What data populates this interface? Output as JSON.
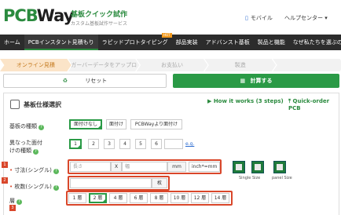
{
  "header": {
    "logo_part1": "PCB",
    "logo_part2": "Way",
    "title": "基板クイック試作",
    "subtitle": "カスタム基板試作サービス",
    "mobile": "モバイル",
    "help": "ヘルプセンター"
  },
  "nav": {
    "items": [
      {
        "label": "ホーム",
        "active": false
      },
      {
        "label": "PCBインスタント見積もり",
        "active": true
      },
      {
        "label": "ラピッドプロトタイピング",
        "active": false
      },
      {
        "label": "部品実装",
        "active": false
      },
      {
        "label": "アドバンスト基板",
        "active": false
      },
      {
        "label": "製品と機能",
        "active": false
      },
      {
        "label": "なぜ私たちを選ぶのか",
        "active": false
      }
    ],
    "badge": "HOT"
  },
  "steps": [
    {
      "label": "オンライン見積",
      "active": true
    },
    {
      "label": "ガーバーデータをアップロ",
      "active": false
    },
    {
      "label": "お支払い",
      "active": false
    },
    {
      "label": "製造",
      "active": false
    },
    {
      "label": "",
      "active": false
    }
  ],
  "actions": {
    "reset": "リセット",
    "calculate": "計算する"
  },
  "section": {
    "title": "基板仕様選択",
    "how_it_works": "How it works (3 steps)",
    "quick_order": "Quick-order PCB"
  },
  "board_type": {
    "label": "基板の種類",
    "options": [
      "面付けなし",
      "面付け",
      "PCBWayより面付け"
    ],
    "selected": 0
  },
  "different_designs": {
    "label_line1": "異なった面付",
    "label_line2": "けの種類",
    "options": [
      "1",
      "2",
      "3",
      "4",
      "5",
      "6"
    ],
    "selected": 0,
    "eg": "e.g."
  },
  "size": {
    "label": "寸法(シングル)",
    "length_placeholder": "長さ",
    "x": "X",
    "width_placeholder": "幅",
    "unit": "mm",
    "conversion": "inch*=mm",
    "single_size": "Single Size",
    "panel_size": "panel Size"
  },
  "quantity": {
    "label": "枚数(シングル)",
    "unit": "枚"
  },
  "layers": {
    "label": "層",
    "options": [
      "1 層",
      "2 層",
      "4 層",
      "6 層",
      "8 層",
      "10 層",
      "12 層",
      "14 層"
    ],
    "selected": 1
  },
  "markers": [
    "1",
    "2",
    "3"
  ]
}
